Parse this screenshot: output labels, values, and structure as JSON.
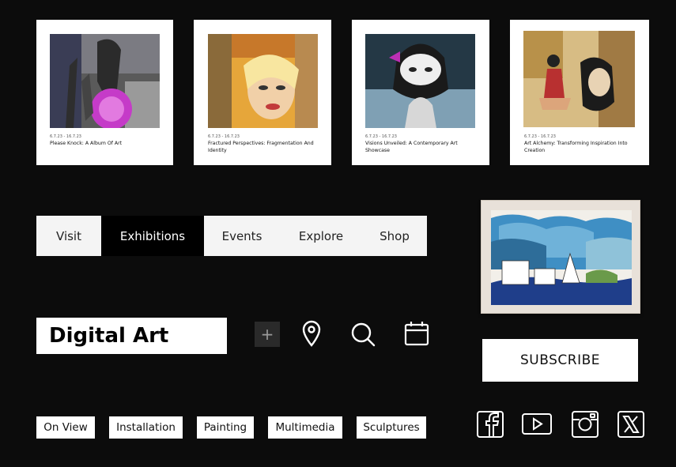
{
  "cards": [
    {
      "date": "6.7.23 - 16.7.23",
      "title": "Please Knock: A Album Of Art"
    },
    {
      "date": "6.7.23 - 16.7.23",
      "title": "Fractured Perspectives: Fragmentation And Identity"
    },
    {
      "date": "6.7.23 - 16.7.23",
      "title": "Visions Unveiled: A Contemporary Art Showcase"
    },
    {
      "date": "6.7.23 - 16.7.23",
      "title": "Art Alchemy: Transforming Inspiration Into Creation"
    }
  ],
  "nav": {
    "items": [
      "Visit",
      "Exhibitions",
      "Events",
      "Explore",
      "Shop"
    ],
    "active": "Exhibitions"
  },
  "search": {
    "value": "Digital Art"
  },
  "actions": {
    "plus": "+"
  },
  "icons": [
    "plus-icon",
    "location-pin-icon",
    "search-icon",
    "calendar-icon",
    "facebook-icon",
    "youtube-icon",
    "instagram-icon",
    "x-icon"
  ],
  "subscribe": {
    "label": "SUBSCRIBE"
  },
  "filters": [
    "On View",
    "Installation",
    "Painting",
    "Multimedia",
    "Sculptures"
  ],
  "colors": {
    "background": "#0c0c0c",
    "surface": "#ffffff",
    "active_tab": "#000000"
  }
}
